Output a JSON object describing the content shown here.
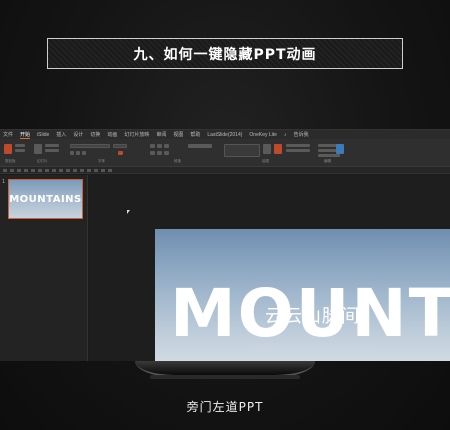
{
  "header": {
    "title": "九、如何一键隐藏PPT动画"
  },
  "app": {
    "menu": [
      "文件",
      "开始",
      "iSlide",
      "插入",
      "设计",
      "切换",
      "动画",
      "幻灯片放映",
      "审阅",
      "视图",
      "帮助",
      "LastSlide(2014)",
      "OneKey Lite",
      "♪",
      "告诉我"
    ],
    "active_menu_index": 1,
    "ribbon_groups": [
      "剪贴板",
      "幻灯片",
      "字体",
      "段落",
      "绘图",
      "编辑"
    ]
  },
  "slides_panel": {
    "slide_number": "1",
    "thumbnail_text": "MOUNTAINS"
  },
  "slide": {
    "title": "MOUNTAINS",
    "subtitle": "云云山脉间"
  },
  "footer": {
    "caption": "旁门左道PPT"
  }
}
